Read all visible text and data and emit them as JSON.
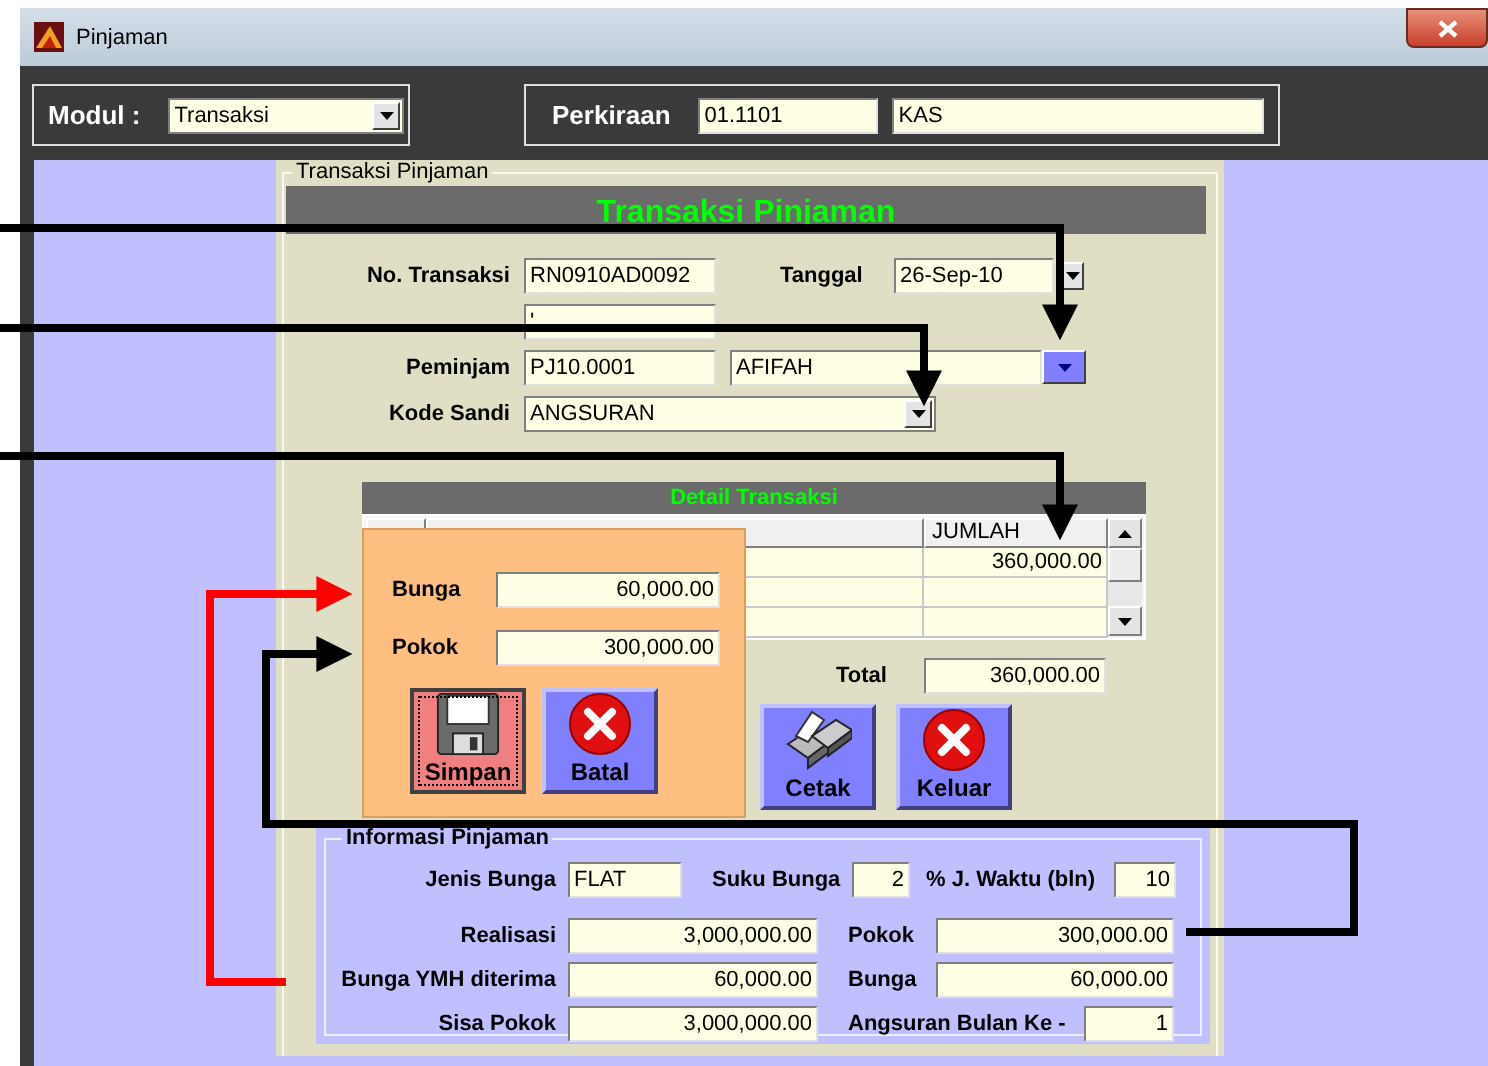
{
  "window": {
    "title": "Pinjaman"
  },
  "toolbar": {
    "modul_label": "Modul :",
    "modul_value": "Transaksi",
    "perkiraan_label": "Perkiraan",
    "perkiraan_code": "01.1101",
    "perkiraan_name": "KAS"
  },
  "panel": {
    "legend": "Transaksi Pinjaman",
    "header": "Transaksi Pinjaman"
  },
  "form": {
    "no_transaksi": {
      "label": "No. Transaksi",
      "value": "RN0910AD0092"
    },
    "tanggal": {
      "label": "Tanggal",
      "value": "26-Sep-10"
    },
    "no_ref": {
      "value": "'"
    },
    "peminjam": {
      "label": "Peminjam",
      "code": "PJ10.0001",
      "name": "AFIFAH"
    },
    "kode_sandi": {
      "label": "Kode Sandi",
      "value": "ANGSURAN"
    }
  },
  "detail": {
    "header": "Detail Transaksi",
    "column_3": "JUMLAH",
    "rows": [
      {
        "jumlah": "360,000.00"
      }
    ]
  },
  "popup": {
    "fields": [
      {
        "label": "Bunga",
        "value": "60,000.00"
      },
      {
        "label": "Pokok",
        "value": "300,000.00"
      }
    ],
    "buttons": [
      {
        "label": "Simpan",
        "kind": "save",
        "focused": true
      },
      {
        "label": "Batal",
        "kind": "cancel",
        "focused": false
      }
    ]
  },
  "total": {
    "label": "Total",
    "value": "360,000.00"
  },
  "buttons": [
    {
      "label": "Cetak",
      "kind": "print"
    },
    {
      "label": "Keluar",
      "kind": "cancel"
    }
  ],
  "info": {
    "legend": "Informasi Pinjaman",
    "rows": [
      [
        {
          "label": "Jenis Bunga",
          "value": "FLAT"
        },
        {
          "label": "Suku Bunga",
          "value": "2"
        },
        {
          "label": "% J. Waktu (bln)",
          "value": "10"
        }
      ],
      [
        {
          "label": "Realisasi",
          "value": "3,000,000.00"
        },
        {
          "label": "Pokok",
          "value": "300,000.00"
        }
      ],
      [
        {
          "label": "Bunga YMH diterima",
          "value": "60,000.00"
        },
        {
          "label": "Bunga",
          "value": "60,000.00"
        }
      ],
      [
        {
          "label": "Sisa Pokok",
          "value": "3,000,000.00"
        },
        {
          "label": "Angsuran Bulan Ke -",
          "value": "1"
        }
      ]
    ]
  },
  "annotations": [
    {
      "color": "#000000"
    },
    {
      "color": "#000000"
    },
    {
      "color": "#000000"
    },
    {
      "color": "#ff0000"
    },
    {
      "color": "#000000"
    }
  ]
}
